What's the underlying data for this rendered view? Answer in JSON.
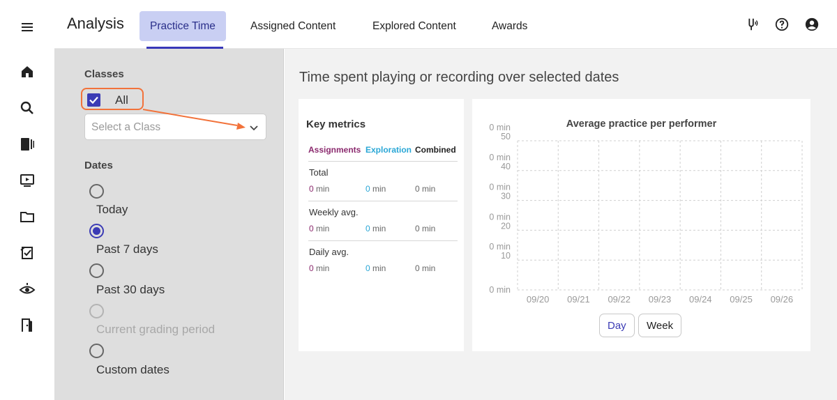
{
  "header": {
    "app_title": "Analysis",
    "tabs": [
      {
        "label": "Practice Time",
        "active": true
      },
      {
        "label": "Assigned Content",
        "active": false
      },
      {
        "label": "Explored Content",
        "active": false
      },
      {
        "label": "Awards",
        "active": false
      }
    ],
    "icons": [
      "tuning-fork-icon",
      "help-circle-icon",
      "account-circle-icon"
    ]
  },
  "rail": {
    "icons": [
      "menu-icon",
      "home-icon",
      "search-icon",
      "library-icon",
      "video-icon",
      "folder-icon",
      "assignments-icon",
      "eye-icon",
      "exit-door-icon"
    ]
  },
  "filters": {
    "classes_heading": "Classes",
    "all_label": "All",
    "all_checked": true,
    "class_select_placeholder": "Select a Class",
    "dates_heading": "Dates",
    "date_options": [
      {
        "label": "Today",
        "checked": false,
        "disabled": false
      },
      {
        "label": "Past 7 days",
        "checked": true,
        "disabled": false
      },
      {
        "label": "Past 30 days",
        "checked": false,
        "disabled": false
      },
      {
        "label": "Current grading period",
        "checked": false,
        "disabled": true
      },
      {
        "label": "Custom dates",
        "checked": false,
        "disabled": false
      }
    ]
  },
  "main": {
    "title": "Time spent playing or recording over selected dates",
    "key_metrics": {
      "title": "Key metrics",
      "columns": [
        {
          "label": "Assignments",
          "color": "#8b2a6e"
        },
        {
          "label": "Exploration",
          "color": "#2aa7d6"
        },
        {
          "label": "Combined",
          "color": "#222222"
        }
      ],
      "rows": [
        {
          "label": "Total",
          "num_a": "0",
          "num_e": "0",
          "num_c": "0",
          "unit": " min"
        },
        {
          "label": "Weekly avg.",
          "num_a": "0",
          "num_e": "0",
          "num_c": "0",
          "unit": " min"
        },
        {
          "label": "Daily avg.",
          "num_a": "0",
          "num_e": "0",
          "num_c": "0",
          "unit": " min"
        }
      ]
    },
    "chart_title": "Average practice per performer",
    "buttons": {
      "day": "Day",
      "week": "Week",
      "active": "day"
    }
  },
  "chart_data": {
    "type": "bar",
    "title": "Average practice per performer",
    "categories": [
      "09/20",
      "09/21",
      "09/22",
      "09/23",
      "09/24",
      "09/25",
      "09/26"
    ],
    "values": [
      0,
      0,
      0,
      0,
      0,
      0,
      0
    ],
    "y_tick_labels": [
      "0 min",
      "0 min 10",
      "0 min 20",
      "0 min 30",
      "0 min 40",
      "0 min 50"
    ],
    "ylim": [
      0,
      50
    ],
    "grid": true,
    "grid_style": "dashed"
  }
}
